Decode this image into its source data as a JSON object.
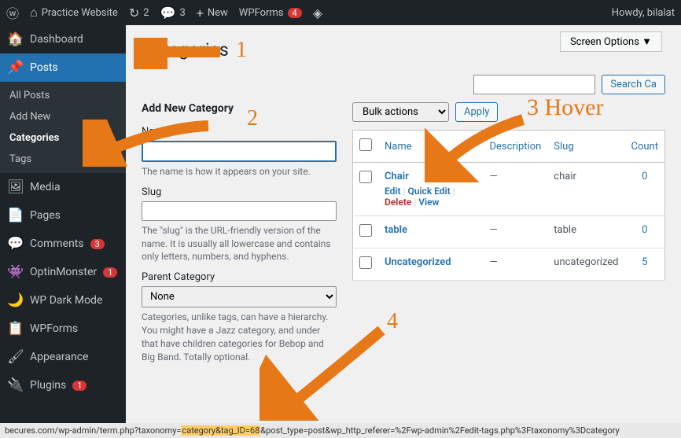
{
  "adminbar": {
    "site": "Practice Website",
    "updates": "2",
    "comments": "3",
    "new": "New",
    "wpforms": "WPForms",
    "wpforms_badge": "4",
    "howdy": "Howdy, bilalat"
  },
  "menu": {
    "dashboard": "Dashboard",
    "posts": "Posts",
    "posts_sub": {
      "all": "All Posts",
      "add": "Add New",
      "cat": "Categories",
      "tags": "Tags"
    },
    "media": "Media",
    "pages": "Pages",
    "comments": "Comments",
    "comments_badge": "3",
    "optin": "OptinMonster",
    "optin_badge": "1",
    "dark": "WP Dark Mode",
    "wpforms": "WPForms",
    "appearance": "Appearance",
    "plugins": "Plugins",
    "plugins_badge": "1"
  },
  "screen_options": "Screen Options ▼",
  "page_title": "Categories",
  "search": {
    "placeholder": "",
    "button": "Search Ca"
  },
  "form": {
    "heading": "Add New Category",
    "name_label": "Name",
    "name_desc": "The name is how it appears on your site.",
    "slug_label": "Slug",
    "slug_desc": "The \"slug\" is the URL-friendly version of the name. It is usually all lowercase and contains only letters, numbers, and hyphens.",
    "parent_label": "Parent Category",
    "parent_option": "None",
    "parent_desc": "Categories, unlike tags, can have a hierarchy. You might have a Jazz category, and under that have children categories for Bebop and Big Band. Totally optional."
  },
  "bulk": {
    "label": "Bulk actions",
    "apply": "Apply"
  },
  "table": {
    "cols": {
      "name": "Name",
      "desc": "Description",
      "slug": "Slug",
      "count": "Count"
    },
    "rows": [
      {
        "name": "Chair",
        "desc": "—",
        "slug": "chair",
        "count": "0",
        "hover": true
      },
      {
        "name": "table",
        "desc": "—",
        "slug": "table",
        "count": "0",
        "hover": false
      },
      {
        "name": "Uncategorized",
        "desc": "—",
        "slug": "uncategorized",
        "count": "5",
        "hover": false
      }
    ],
    "actions": {
      "edit": "Edit",
      "quick": "Quick Edit",
      "delete": "Delete",
      "view": "View"
    }
  },
  "status": {
    "pre": "becures.com/wp-admin/term.php?taxonomy=",
    "hi": "category&tag_ID=68",
    "post": "post_type=post&wp_http_referer=%2Fwp-admin%2Fedit-tags.php%3Ftaxonomy%3Dcategory"
  },
  "ann": {
    "n1": "1",
    "n2": "2",
    "n3": "3 Hover",
    "n4": "4"
  }
}
